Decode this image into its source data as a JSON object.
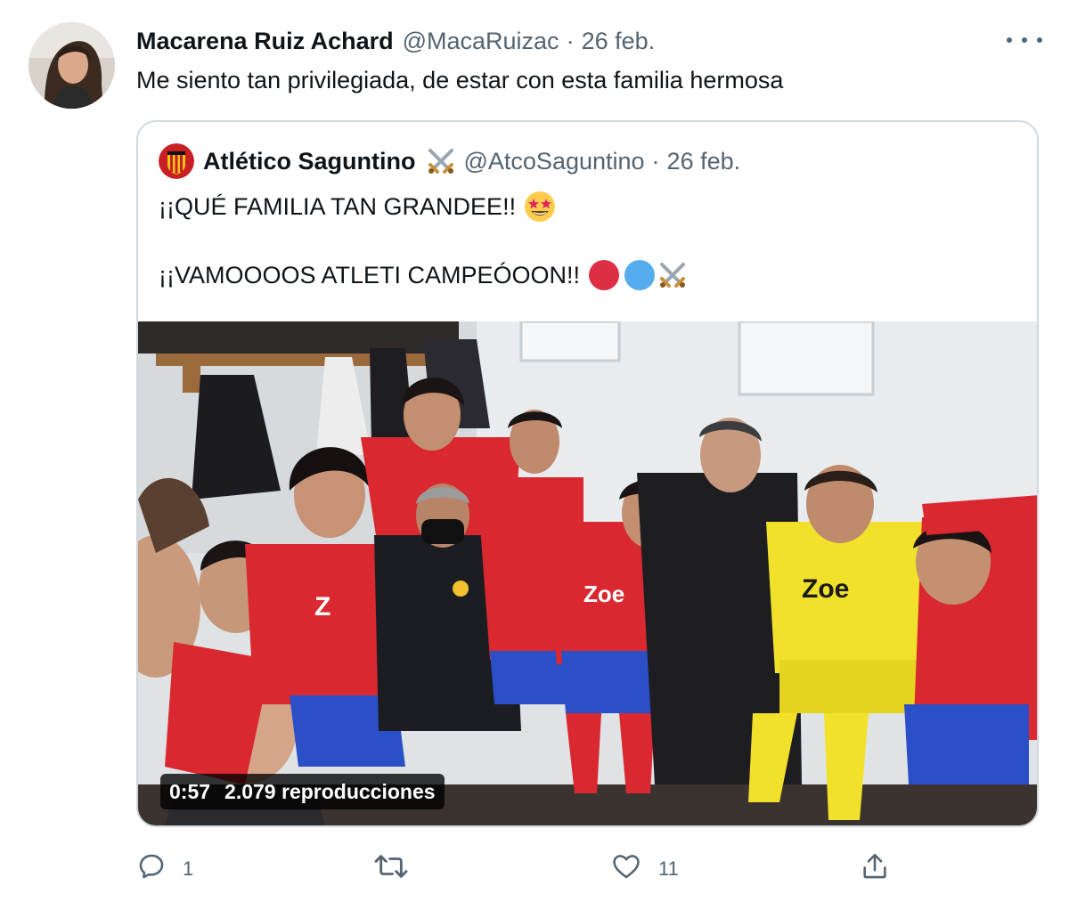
{
  "tweet": {
    "author_name": "Macarena Ruiz Achard",
    "author_handle": "@MacaRuizac",
    "separator": "·",
    "date": "26 feb.",
    "text": "Me siento tan privilegiada, de estar con esta familia hermosa"
  },
  "quoted": {
    "author_name": "Atlético Saguntino",
    "author_handle": "@AtcoSaguntino",
    "separator": "·",
    "date": "26 feb.",
    "line1": "¡¡QUÉ FAMILIA TAN GRANDEE!!",
    "line2": "¡¡VAMOOOOS ATLETI CAMPEÓOON!!",
    "media": {
      "duration": "0:57",
      "views": "2.079 reproducciones",
      "jersey_sponsor": "Zoe"
    }
  },
  "actions": {
    "reply_count": "1",
    "retweet_count": "",
    "like_count": "11",
    "share_count": ""
  },
  "icons": {
    "more": "more-horizontal-icon",
    "reply": "reply-icon",
    "retweet": "retweet-icon",
    "like": "like-icon",
    "share": "share-icon",
    "swords": "crossed-swords-emoji",
    "star_eyes": "star-struck-emoji",
    "red_circle": "red-circle-emoji",
    "blue_circle": "blue-circle-emoji"
  },
  "colors": {
    "text_primary": "#0f1419",
    "text_secondary": "#536471",
    "border": "#cfd9de",
    "jersey_red": "#d9282f",
    "shorts_blue": "#2b4fc7",
    "keeper_yellow": "#f2e12a",
    "emoji_red": "#dd2e44",
    "emoji_blue": "#55acee"
  }
}
